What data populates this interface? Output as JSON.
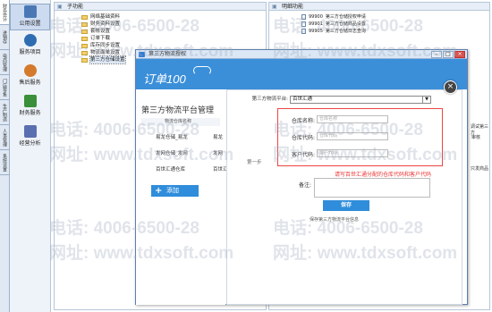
{
  "left_tabs": [
    "财务会计",
    "进销存",
    "电商管理",
    "门店零售",
    "生产制造",
    "人事管理",
    "系统设置"
  ],
  "sidebar": [
    {
      "label": "公用设置",
      "icon": "settings-icon",
      "color": "#4a78b5"
    },
    {
      "label": "服务项目",
      "icon": "user-icon",
      "color": "#2f6db3"
    },
    {
      "label": "售后服务",
      "icon": "customer-service-icon",
      "color": "#d47a2c"
    },
    {
      "label": "财务服务",
      "icon": "coins-icon",
      "color": "#3a8f3a"
    },
    {
      "label": "经营分析",
      "icon": "chart-icon",
      "color": "#5a6fb0"
    }
  ],
  "sub_panel": {
    "title": "子功能",
    "items": [
      "网络基础资料",
      "财务资料设置",
      "套帐设置",
      "订单下载",
      "库存同步设置",
      "物流面单设置",
      "第三方仓储设置"
    ],
    "selected_index": 6
  },
  "detail_panel": {
    "title": "明细功能",
    "items": [
      {
        "code": "99900",
        "label": "第三方仓储授权申请"
      },
      {
        "code": "99901",
        "label": "第三方仓储商品设置"
      },
      {
        "code": "99905",
        "label": "第三方仓储日志查询"
      }
    ],
    "edge_texts": [
      "调试第三方",
      "审核",
      "只发商品"
    ]
  },
  "dialog": {
    "title": "第三方物流授权",
    "brand": "订单100",
    "heading": "第三方物流平台管理",
    "list_header": "物流仓库名称",
    "warehouses": [
      {
        "name": "易龙仓储_易龙",
        "partner": "易龙"
      },
      {
        "name": "发网仓储_发网",
        "partner": "发网"
      },
      {
        "name": "百世汇通仓库",
        "partner": "百世汇"
      }
    ],
    "add_label": "添加",
    "step_label": "第一步",
    "platform_label": "第三方物流平台:",
    "platform_value": "百世汇通",
    "warehouse_name_label": "仓库名称:",
    "warehouse_name_placeholder": "仓库名称",
    "warehouse_code_label": "仓库代码:",
    "warehouse_code_placeholder": "仓库代码",
    "customer_code_label": "客户代码:",
    "customer_code_placeholder": "客户代码",
    "hint": "请写百世汇通分配的仓库代码和客户代码",
    "remark_label": "备注:",
    "save_label": "保存",
    "save_tip": "保存第三方物流平台信息"
  },
  "watermark": {
    "phone": "电话: 4006-6500-28",
    "site": "网址: www.tdxsoft.com"
  }
}
